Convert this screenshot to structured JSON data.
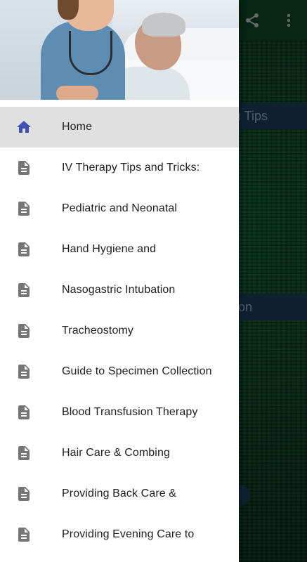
{
  "background": {
    "chip_1": "(IV) Tips",
    "chip_2": "paration",
    "chip_3": "",
    "icons": {
      "share": "share-icon",
      "more": "more-vert-icon"
    }
  },
  "drawer": {
    "header_image": "nurse-with-patient-photo",
    "items": [
      {
        "label": "Home",
        "icon": "home-icon",
        "active": true
      },
      {
        "label": "IV Therapy Tips and Tricks:",
        "icon": "document-icon"
      },
      {
        "label": "Pediatric and Neonatal",
        "icon": "document-icon"
      },
      {
        "label": "Hand Hygiene and",
        "icon": "document-icon"
      },
      {
        "label": "Nasogastric Intubation",
        "icon": "document-icon"
      },
      {
        "label": "Tracheostomy",
        "icon": "document-icon"
      },
      {
        "label": "Guide to Specimen Collection",
        "icon": "document-icon"
      },
      {
        "label": "Blood Transfusion Therapy",
        "icon": "document-icon"
      },
      {
        "label": "Hair Care & Combing",
        "icon": "document-icon"
      },
      {
        "label": "Providing Back Care &",
        "icon": "document-icon"
      },
      {
        "label": "Providing Evening Care to",
        "icon": "document-icon"
      }
    ]
  },
  "colors": {
    "accent": "#3f51b5",
    "icon_gray": "#757575",
    "toolbar_bg": "#0c4424"
  }
}
